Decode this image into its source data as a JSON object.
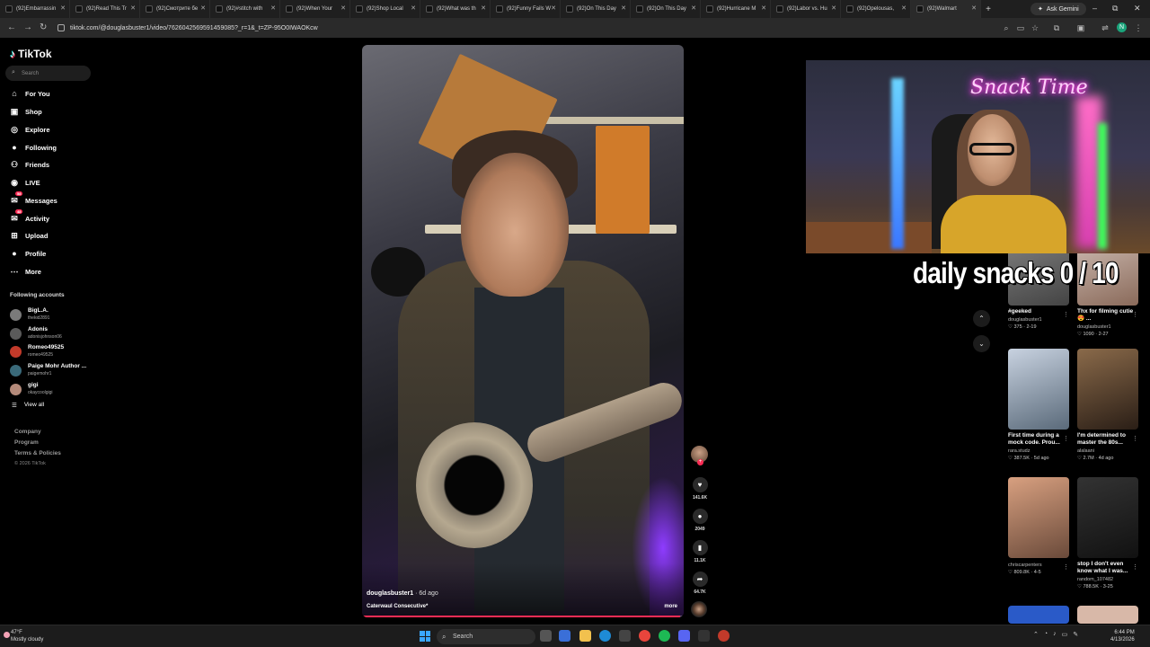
{
  "browser": {
    "tabs": [
      {
        "label": "(92)Embarrassin"
      },
      {
        "label": "(92)Read This Tr"
      },
      {
        "label": "(92)Смотрите бе"
      },
      {
        "label": "(92)#stitch with"
      },
      {
        "label": "(92)When Your"
      },
      {
        "label": "(92)Shop Local"
      },
      {
        "label": "(92)What was th"
      },
      {
        "label": "(92)Funny Fails W"
      },
      {
        "label": "(92)On This Day"
      },
      {
        "label": "(92)On This Day"
      },
      {
        "label": "(92)Hurricane M"
      },
      {
        "label": "(92)Labor vs. Hu"
      },
      {
        "label": "(92)Opelousas,"
      },
      {
        "label": "(92)Walmart"
      }
    ],
    "new_tab_label": "+",
    "ask_gemini_label": "Ask Gemini",
    "url": "tiktok.com/@douglasbuster1/video/7626042569591459085?_r=1&_t=ZP-95O0IWAOKcw",
    "profile_initial": "N",
    "window_controls": {
      "minimize": "–",
      "maximize": "⧉",
      "close": "✕"
    }
  },
  "sidebar": {
    "logo_text": "TikTok",
    "search_placeholder": "Search",
    "nav_items": [
      {
        "label": "For You",
        "icon": "home-icon"
      },
      {
        "label": "Shop",
        "icon": "shopping-bag-icon"
      },
      {
        "label": "Explore",
        "icon": "compass-icon"
      },
      {
        "label": "Following",
        "icon": "following-avatar-icon"
      },
      {
        "label": "Friends",
        "icon": "friends-icon"
      },
      {
        "label": "LIVE",
        "icon": "live-icon"
      },
      {
        "label": "Messages",
        "icon": "messages-icon",
        "badge": "58"
      },
      {
        "label": "Activity",
        "icon": "activity-icon",
        "badge": "48"
      },
      {
        "label": "Upload",
        "icon": "upload-icon"
      },
      {
        "label": "Profile",
        "icon": "profile-avatar-icon"
      },
      {
        "label": "More",
        "icon": "more-icon"
      }
    ],
    "following_title": "Following accounts",
    "following_accounts": [
      {
        "name": "BigL.A.",
        "handle": "thekid2891",
        "color": "#7a7a7a"
      },
      {
        "name": "Adonis",
        "handle": "adonisjohnson06",
        "color": "#5a5a5a"
      },
      {
        "name": "Romeo49525",
        "handle": "romeo49525",
        "color": "#c23a2a"
      },
      {
        "name": "Paige Mohr Author ...",
        "handle": "paigemohr1",
        "color": "#3a6a7a"
      },
      {
        "name": "gigi",
        "handle": "okaycoolgigi",
        "color": "#b48a7a"
      }
    ],
    "view_all": "View all",
    "footer_links": [
      "Company",
      "Program",
      "Terms & Policies"
    ],
    "copyright": "© 2026 TikTok"
  },
  "video": {
    "author": "douglasbuster1",
    "age": "· 6d ago",
    "caption": "Caterwaul Consecutive*",
    "more_label": "more",
    "progress_fraction": 0.99
  },
  "actions": {
    "likes": "141.6K",
    "comments": "2049",
    "saves": "11.1K",
    "shares": "64.7K"
  },
  "stream_overlay": {
    "neon_sign": "Snack Time",
    "snacks_label": "daily snacks  0 / 10"
  },
  "recommendations": [
    {
      "title": "#geeked",
      "author": "douglasbuster1",
      "likes": "375",
      "date": "2-19"
    },
    {
      "title": "Thx for filming cutie 😍 ...",
      "author": "douglasbuster1",
      "likes": "1090",
      "date": "2-27"
    },
    {
      "title": "First time during a mock code. Prou...",
      "author": "rara.studz",
      "likes": "387.5K",
      "date": "5d ago"
    },
    {
      "title": "I'm determined to master the 80s...",
      "author": "alalaani",
      "likes": "2.7M",
      "date": "4d ago"
    },
    {
      "title": "",
      "author": "chriscarpenters",
      "likes": "809.8K",
      "date": "4-5"
    },
    {
      "title": "stop I don't even know what I was...",
      "author": "random_107482",
      "likes": "788.5K",
      "date": "3-25"
    }
  ],
  "taskbar": {
    "weather_temp": "47°F",
    "weather_desc": "Mostly cloudy",
    "search_label": "Search",
    "time": "6:44 PM",
    "date": "4/13/2026"
  }
}
